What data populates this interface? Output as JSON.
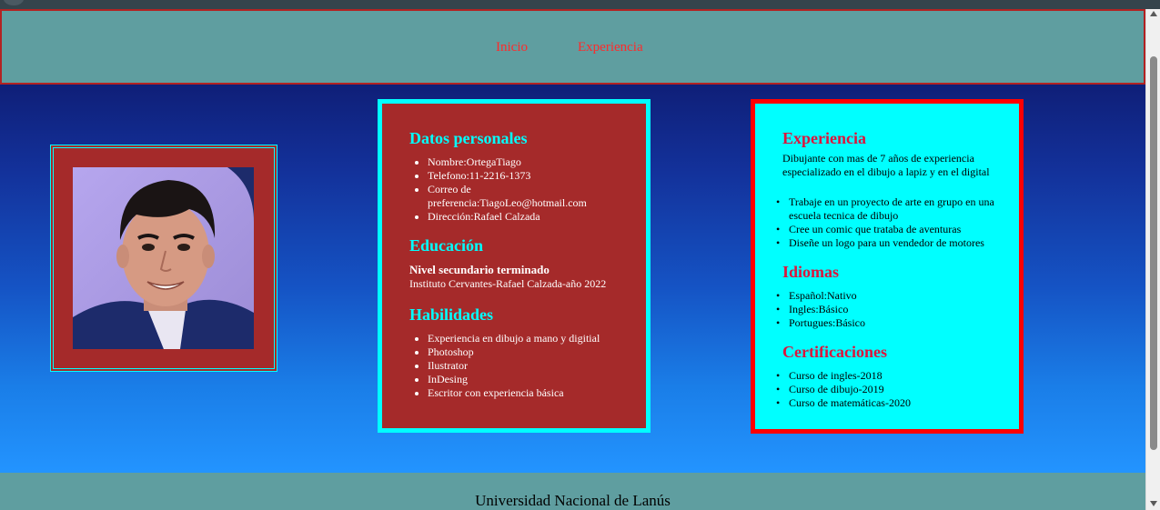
{
  "nav": {
    "items": [
      "Inicio",
      "Experiencia"
    ]
  },
  "datos": {
    "title": "Datos personales",
    "items": [
      "Nombre:OrtegaTiago",
      "Telefono:11-2216-1373",
      "Correo de preferencia:TiagoLeo@hotmail.com",
      "Dirección:Rafael Calzada"
    ]
  },
  "educacion": {
    "title": "Educación",
    "level": "Nivel secundario terminado",
    "school": "Instituto Cervantes-Rafael Calzada-año 2022"
  },
  "habilidades": {
    "title": "Habilidades",
    "items": [
      "Experiencia en dibujo a mano y digitial",
      "Photoshop",
      "Ilustrator",
      "InDesing",
      "Escritor con experiencia básica"
    ]
  },
  "experiencia": {
    "title": "Experiencia",
    "summary": "Dibujante con mas de 7 años de experiencia especializado en el dibujo a lapiz y en el digital",
    "items": [
      "Trabaje en un proyecto de arte en grupo en una escuela tecnica de dibujo",
      "Cree un comic que trataba de aventuras",
      "Diseñe un logo para un vendedor de motores"
    ]
  },
  "idiomas": {
    "title": "Idiomas",
    "items": [
      "Español:Nativo",
      "Ingles:Básico",
      "Portugues:Básico"
    ]
  },
  "certificaciones": {
    "title": "Certificaciones",
    "items": [
      "Curso de ingles-2018",
      "Curso de dibujo-2019",
      "Curso de matemáticas-2020"
    ]
  },
  "footer": {
    "text": "Universidad Nacional de Lanús"
  },
  "colors": {
    "nav_bg": "#5f9ea0",
    "nav_link": "#ff2a2a",
    "card1_bg": "#a52a2a",
    "card1_border": "#00ffff",
    "card2_bg": "#00ffff",
    "card2_border": "#ff0000",
    "card2_heading": "#dc143c"
  }
}
